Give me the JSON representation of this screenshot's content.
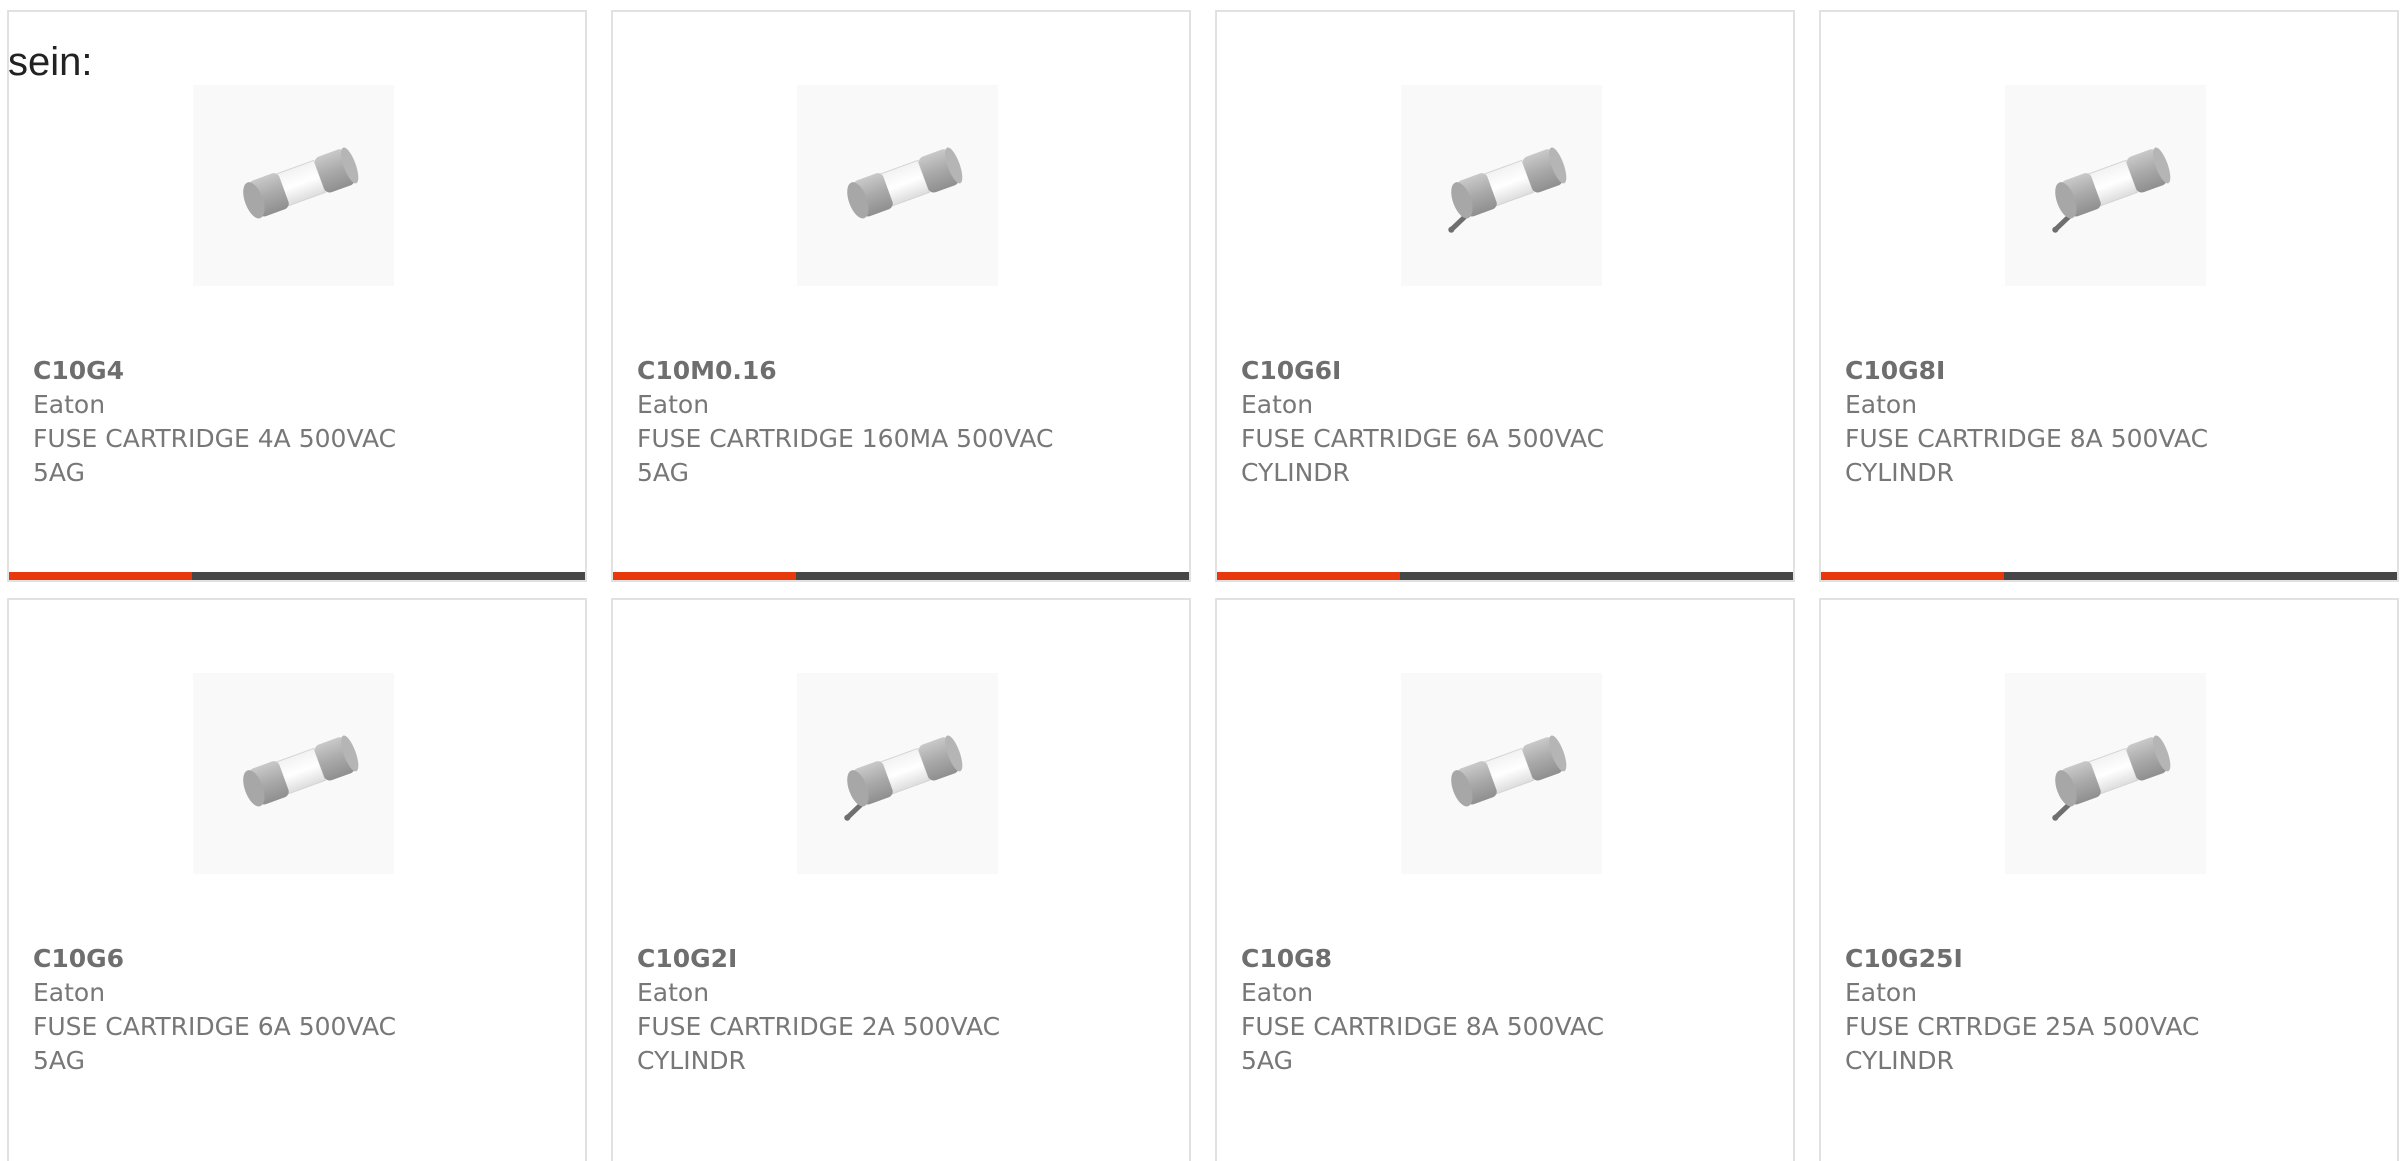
{
  "intro_text": "sein:",
  "colors": {
    "accent": "#e8390c",
    "bar": "#474747",
    "border": "#e1e1e1",
    "text": "#777777"
  },
  "products": [
    {
      "part_number": "C10G4",
      "manufacturer": "Eaton",
      "desc_line1": "FUSE CARTRIDGE 4A 500VAC",
      "desc_line2": "5AG",
      "image_icon": "fuse-cartridge-icon"
    },
    {
      "part_number": "C10M0.16",
      "manufacturer": "Eaton",
      "desc_line1": "FUSE CARTRIDGE 160MA 500VAC",
      "desc_line2": "5AG",
      "image_icon": "fuse-cartridge-icon"
    },
    {
      "part_number": "C10G6I",
      "manufacturer": "Eaton",
      "desc_line1": "FUSE CARTRIDGE 6A 500VAC",
      "desc_line2": "CYLINDR",
      "image_icon": "fuse-cartridge-pin-icon"
    },
    {
      "part_number": "C10G8I",
      "manufacturer": "Eaton",
      "desc_line1": "FUSE CARTRIDGE 8A 500VAC",
      "desc_line2": "CYLINDR",
      "image_icon": "fuse-cartridge-pin-icon"
    },
    {
      "part_number": "C10G6",
      "manufacturer": "Eaton",
      "desc_line1": "FUSE CARTRIDGE 6A 500VAC",
      "desc_line2": "5AG",
      "image_icon": "fuse-cartridge-icon"
    },
    {
      "part_number": "C10G2I",
      "manufacturer": "Eaton",
      "desc_line1": "FUSE CARTRIDGE 2A 500VAC",
      "desc_line2": "CYLINDR",
      "image_icon": "fuse-cartridge-pin-icon"
    },
    {
      "part_number": "C10G8",
      "manufacturer": "Eaton",
      "desc_line1": "FUSE CARTRIDGE 8A 500VAC",
      "desc_line2": "5AG",
      "image_icon": "fuse-cartridge-icon"
    },
    {
      "part_number": "C10G25I",
      "manufacturer": "Eaton",
      "desc_line1": "FUSE CRTRDGE 25A 500VAC",
      "desc_line2": "CYLINDR",
      "image_icon": "fuse-cartridge-pin-icon"
    }
  ]
}
